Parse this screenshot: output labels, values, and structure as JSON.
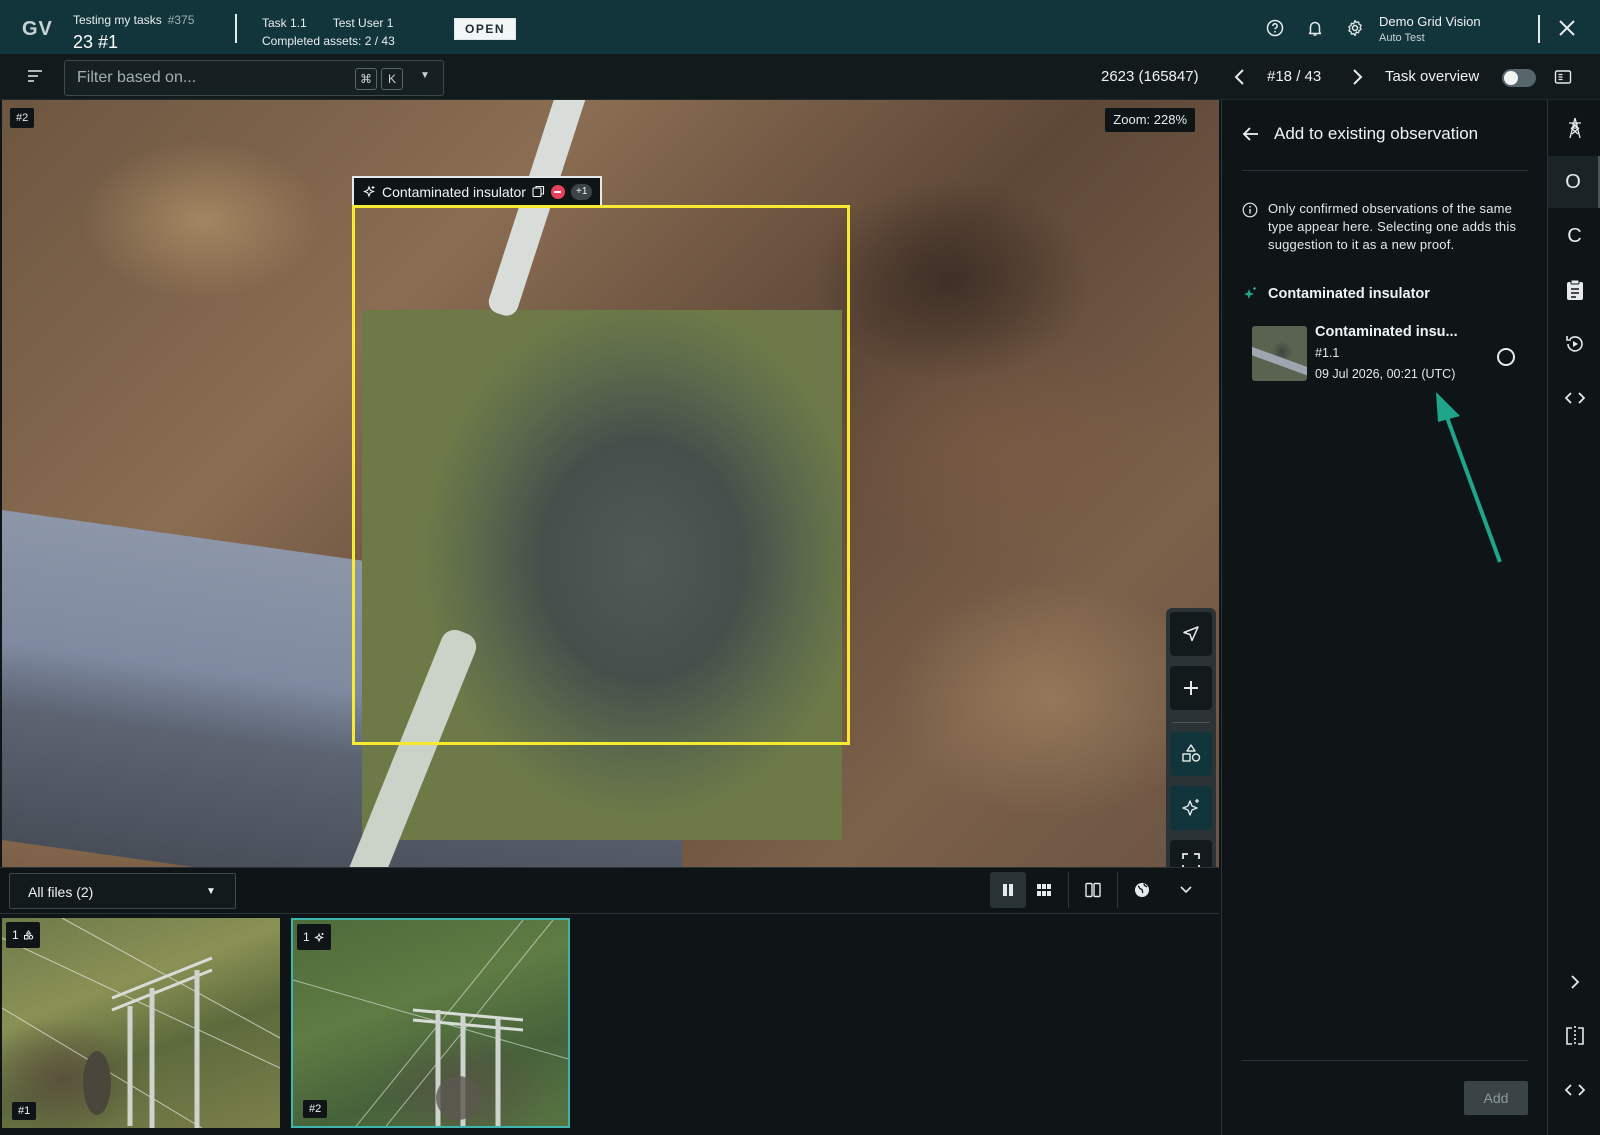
{
  "app": {
    "logo": "GV",
    "project_name": "Testing my tasks",
    "project_id": "#375",
    "project_big": "23 #1",
    "task": "Task 1.1",
    "user": "Test User 1",
    "completed": "Completed assets: 2 / 43",
    "status": "OPEN"
  },
  "account": {
    "org": "Demo Grid Vision",
    "sub": "Auto Test"
  },
  "toolbar": {
    "filter_placeholder": "Filter based on...",
    "kbd_cmd": "⌘",
    "kbd_k": "K",
    "asset_id": "2623 (165847)",
    "pager": "#18 / 43",
    "task_overview": "Task overview",
    "task_overview_on": false
  },
  "viewer": {
    "image_tag": "#2",
    "zoom": "Zoom: 228%",
    "annotation_label": "Contaminated insulator",
    "annotation_extra": "+1",
    "box_color": "#f7ea2f"
  },
  "files": {
    "selector": "All files (2)",
    "thumbs": [
      {
        "count": "1",
        "icon": "shapes-icon",
        "label": "#1"
      },
      {
        "count": "1",
        "icon": "sparkle-icon",
        "label": "#2"
      }
    ]
  },
  "panel": {
    "title": "Add to existing observation",
    "info": "Only confirmed observations of the same type appear here. Selecting one adds this suggestion to it as a new proof.",
    "type": "Contaminated insulator",
    "observation": {
      "title": "Contaminated insu...",
      "id": "#1.1",
      "date": "09 Jul 2026, 00:21 (UTC)"
    },
    "add_label": "Add",
    "accent": "#1fa58a"
  },
  "rail": {
    "o": "O",
    "c": "C"
  }
}
